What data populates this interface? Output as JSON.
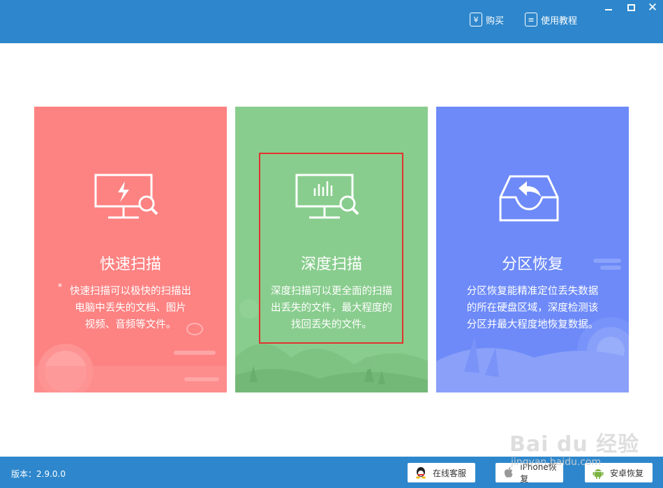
{
  "titlebar": {
    "buy_label": "购买",
    "buy_icon": "yen-icon",
    "tutorial_label": "使用教程",
    "tutorial_icon": "document-icon",
    "window_controls": [
      "minimize-icon",
      "maximize-icon",
      "close-icon"
    ]
  },
  "cards": [
    {
      "title": "快速扫描",
      "desc_lines": [
        "快速扫描可以极快的扫描出",
        "电脑中丢失的文档、图片",
        "视频、音频等文件。"
      ],
      "icon": "monitor-bolt-search-icon",
      "color": "#fd8282"
    },
    {
      "title": "深度扫描",
      "desc_lines": [
        "深度扫描可以更全面的扫描",
        "出丢失的文件，最大程度的",
        "找回丢失的文件。"
      ],
      "icon": "monitor-chart-search-icon",
      "color": "#89cd8e"
    },
    {
      "title": "分区恢复",
      "desc_lines": [
        "分区恢复能精准定位丢失数据",
        "的所在硬盘区域，深度检测该",
        "分区并最大程度地恢复数据。"
      ],
      "icon": "tray-restore-icon",
      "color": "#6d8af8"
    }
  ],
  "footer": {
    "version": "版本：2.9.0.0",
    "buttons": [
      {
        "label": "在线客服",
        "icon": "qq-icon"
      },
      {
        "label": "iPhone恢复",
        "icon": "apple-icon"
      },
      {
        "label": "安卓恢复",
        "icon": "android-icon"
      }
    ]
  },
  "watermark": {
    "text": "Bai du 经验",
    "sub": "jingyan.baidu.com"
  },
  "colors": {
    "accent": "#2e87cc",
    "highlight": "#e0322f"
  }
}
